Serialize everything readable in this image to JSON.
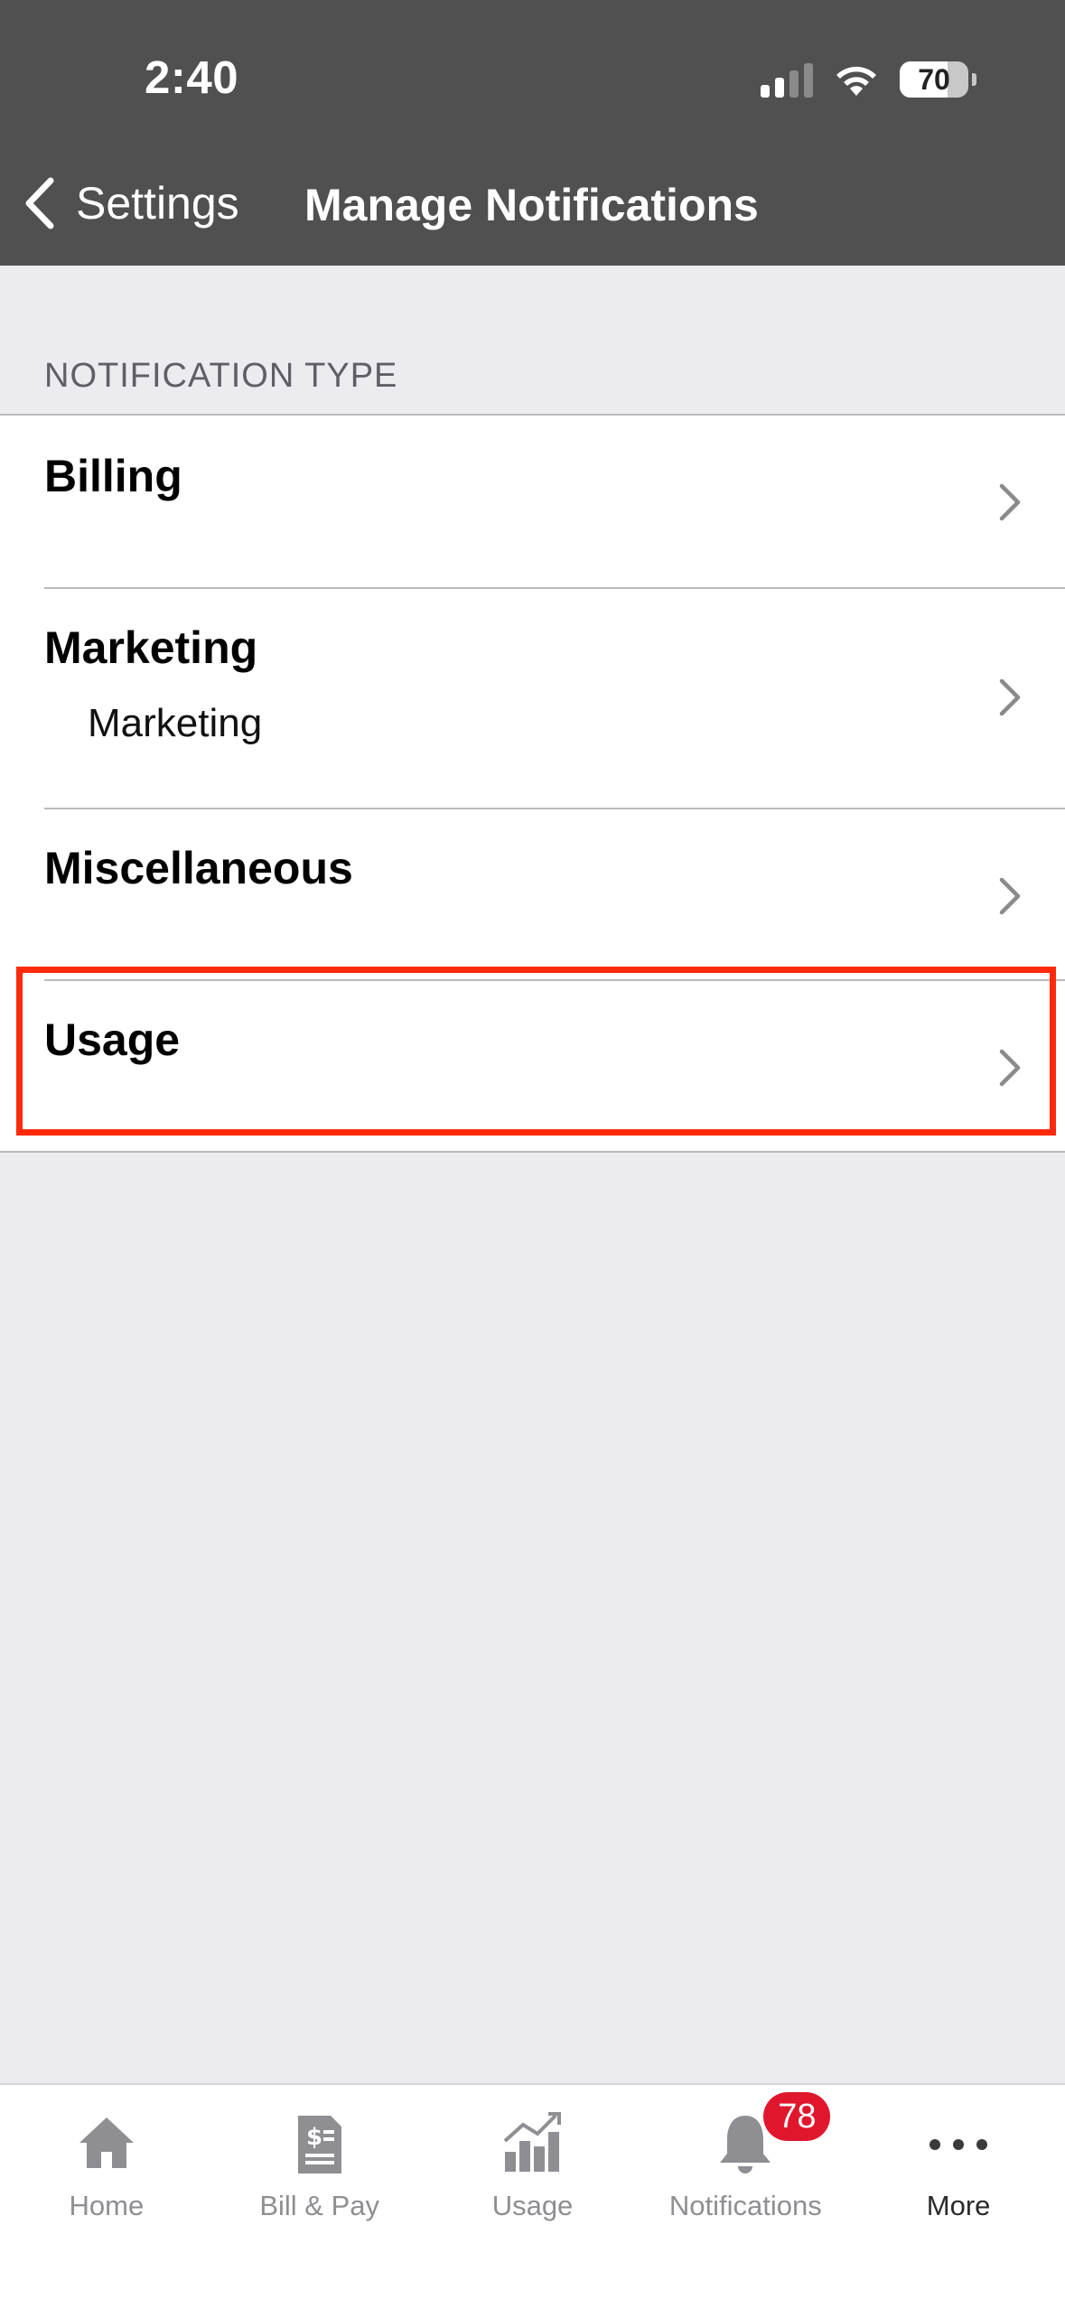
{
  "status_bar": {
    "time": "2:40",
    "battery": "70"
  },
  "nav": {
    "back_label": "Settings",
    "title": "Manage Notifications"
  },
  "section": {
    "label": "NOTIFICATION TYPE"
  },
  "rows": [
    {
      "title": "Billing",
      "subtitle": ""
    },
    {
      "title": "Marketing",
      "subtitle": "Marketing"
    },
    {
      "title": "Miscellaneous",
      "subtitle": ""
    },
    {
      "title": "Usage",
      "subtitle": ""
    }
  ],
  "tabs": [
    {
      "label": "Home",
      "icon": "home-icon"
    },
    {
      "label": "Bill & Pay",
      "icon": "bill-icon"
    },
    {
      "label": "Usage",
      "icon": "usage-chart-icon"
    },
    {
      "label": "Notifications",
      "icon": "bell-icon",
      "badge": "78"
    },
    {
      "label": "More",
      "icon": "more-dots-icon",
      "active": true
    }
  ],
  "colors": {
    "header_bg": "#505050",
    "highlight": "#ff2a0a",
    "badge": "#e0172c"
  }
}
